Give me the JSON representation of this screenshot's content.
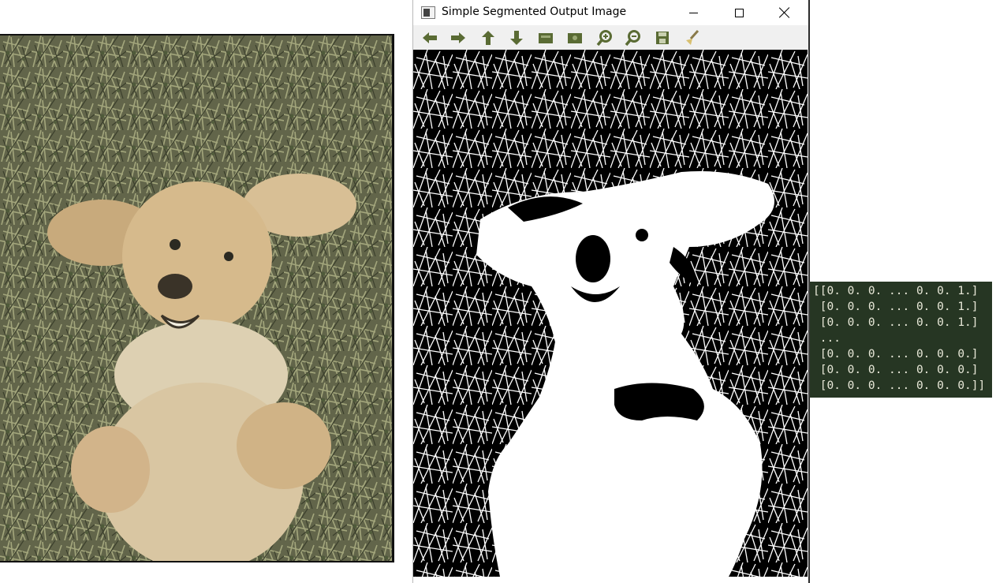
{
  "window": {
    "title": "Simple Segmented Output Image"
  },
  "toolbar": {
    "tools": [
      {
        "name": "back-arrow-icon"
      },
      {
        "name": "forward-arrow-icon"
      },
      {
        "name": "up-arrow-icon"
      },
      {
        "name": "down-arrow-icon"
      },
      {
        "name": "pan-icon"
      },
      {
        "name": "zoom-rect-icon"
      },
      {
        "name": "zoom-in-icon"
      },
      {
        "name": "zoom-out-icon"
      },
      {
        "name": "save-icon"
      },
      {
        "name": "brush-icon"
      }
    ],
    "icon_color": "#5a6b34"
  },
  "console": {
    "lines": [
      "[[0. 0. 0. ... 0. 0. 1.]",
      " [0. 0. 0. ... 0. 0. 1.]",
      " [0. 0. 0. ... 0. 0. 1.]",
      " ...",
      " [0. 0. 0. ... 0. 0. 0.]",
      " [0. 0. 0. ... 0. 0. 0.]",
      " [0. 0. 0. ... 0. 0. 0.]]"
    ],
    "background": "#263623",
    "text_color": "#e8e8d8"
  },
  "colors": {
    "photo_grass": "#6f7150",
    "dog_fur": "#d9bf93",
    "segmented_fg": "#ffffff",
    "segmented_bg": "#000000"
  }
}
